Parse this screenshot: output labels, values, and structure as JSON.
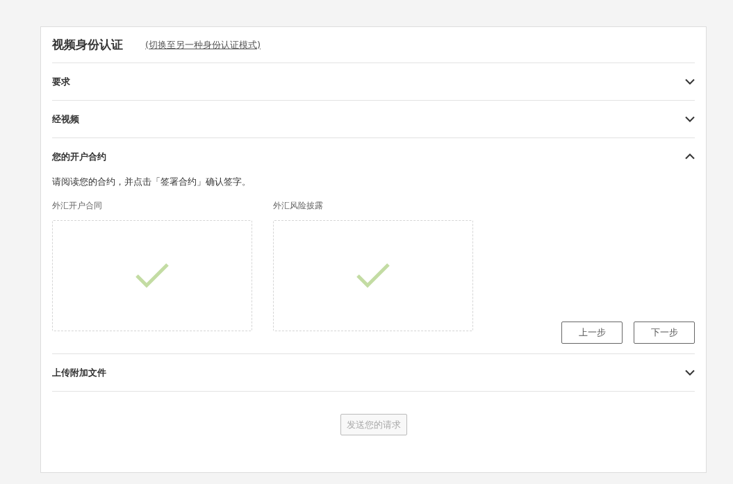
{
  "title": "视频身份认证",
  "switch_link": "(切换至另一种身份认证模式)",
  "sections": [
    {
      "title": "要求",
      "expanded": false
    },
    {
      "title": "经视频",
      "expanded": false
    },
    {
      "title": "您的开户合约",
      "expanded": true,
      "instruction": "请阅读您的合约，并点击「签署合约」确认签字。",
      "documents": [
        {
          "label": "外汇开户合同",
          "signed": true
        },
        {
          "label": "外汇风险披露",
          "signed": true
        }
      ],
      "buttons": [
        {
          "label": "上一步"
        },
        {
          "label": "下一步"
        }
      ]
    },
    {
      "title": "上传附加文件",
      "expanded": false
    }
  ],
  "submit": {
    "label": "发送您的请求",
    "disabled": true
  }
}
